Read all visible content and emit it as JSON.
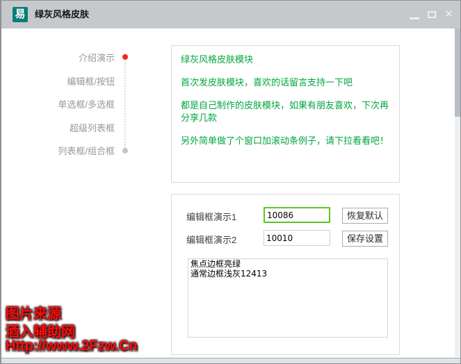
{
  "window": {
    "title": "绿灰风格皮肤",
    "icon_glyph": "易",
    "controls": {
      "minimize": "minimize-icon",
      "maximize": "maximize-icon",
      "close_glyph": "✕"
    }
  },
  "sidebar": {
    "items": [
      {
        "label": "介绍演示",
        "active": true
      },
      {
        "label": "编辑框/按钮",
        "active": false
      },
      {
        "label": "单选框/多选框",
        "active": false
      },
      {
        "label": "超级列表框",
        "active": false
      },
      {
        "label": "列表框/组合框",
        "active": false
      }
    ]
  },
  "intro_panel": {
    "paragraphs": [
      "绿灰风格皮肤模块",
      "首次发皮肤模块，喜欢的话留言支持一下吧",
      "都是自己制作的皮肤模块，如果有朋友喜欢，下次再分享几款",
      "另外简单做了个窗口加滚动条例子，请下拉看看吧！"
    ]
  },
  "form_panel": {
    "rows": [
      {
        "label": "编辑框演示1",
        "value": "10086",
        "button": "恢复默认",
        "focused": true
      },
      {
        "label": "编辑框演示2",
        "value": "10010",
        "button": "保存设置",
        "focused": false
      }
    ],
    "textarea_value": "焦点边框亮绿\n通常边框浅灰12413"
  },
  "watermark": {
    "lines": [
      "图片来源",
      "酒入辅助网",
      "Http://www.2Fzw.Cn"
    ]
  },
  "colors": {
    "titlebar": "#c6c9cc",
    "accent_green_text": "#00a63f",
    "focus_border_green": "#5fc41f",
    "normal_border_gray": "#cfcfcf",
    "active_dot_red": "#f02817",
    "watermark_red": "#f50f0f",
    "icon_teal": "#0b7d78",
    "sidebar_text": "#989898"
  }
}
